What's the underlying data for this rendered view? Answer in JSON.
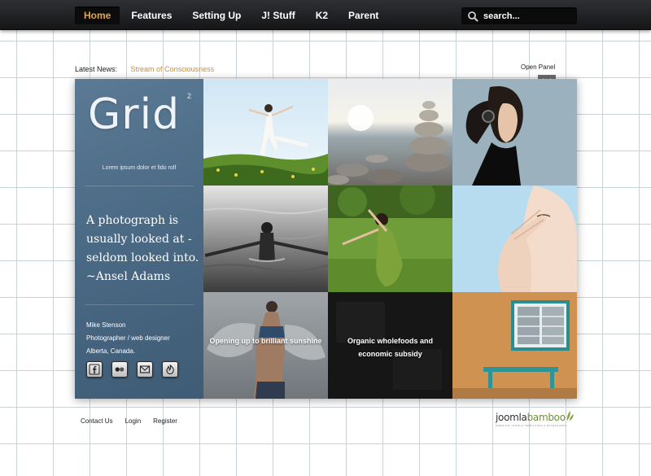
{
  "nav": {
    "items": [
      {
        "label": "Home",
        "active": true
      },
      {
        "label": "Features",
        "active": false
      },
      {
        "label": "Setting Up",
        "active": false
      },
      {
        "label": "J! Stuff",
        "active": false
      },
      {
        "label": "K2",
        "active": false
      },
      {
        "label": "Parent",
        "active": false
      }
    ],
    "search": {
      "placeholder": "search..."
    }
  },
  "news": {
    "label": "Latest News:",
    "headline": "Stream of Consciousness"
  },
  "panel": {
    "label": "Open Panel"
  },
  "sidebar": {
    "brand": "Grid",
    "brand_sup": "2",
    "tagline": "Lorem ipsum dolor et fido rolf",
    "quote": "A photograph is usually looked at - seldom looked into. ~Ansel Adams",
    "author": {
      "name": "Mike Stenson",
      "role": "Photographer / web designer",
      "location": "Alberta, Canada."
    },
    "socials": [
      "facebook-icon",
      "flickr-icon",
      "mail-icon",
      "feed-icon"
    ]
  },
  "tiles": {
    "captions": {
      "sunshine": "Opening up to brilliant sunshine",
      "wholefoods": "Organic wholefoods and economic subsidy"
    }
  },
  "footer": {
    "links": [
      "Contact Us",
      "Login",
      "Register"
    ]
  },
  "logo": {
    "part1": "joomla",
    "part2": "bamboo",
    "sub": "PREMIUM JOOMLA TEMPLATES & EXTENSIONS"
  },
  "colors": {
    "accent": "#e3a64a",
    "link": "#d48a32",
    "sidebar": "#4b6a85",
    "logo_green": "#6d8f3a"
  }
}
